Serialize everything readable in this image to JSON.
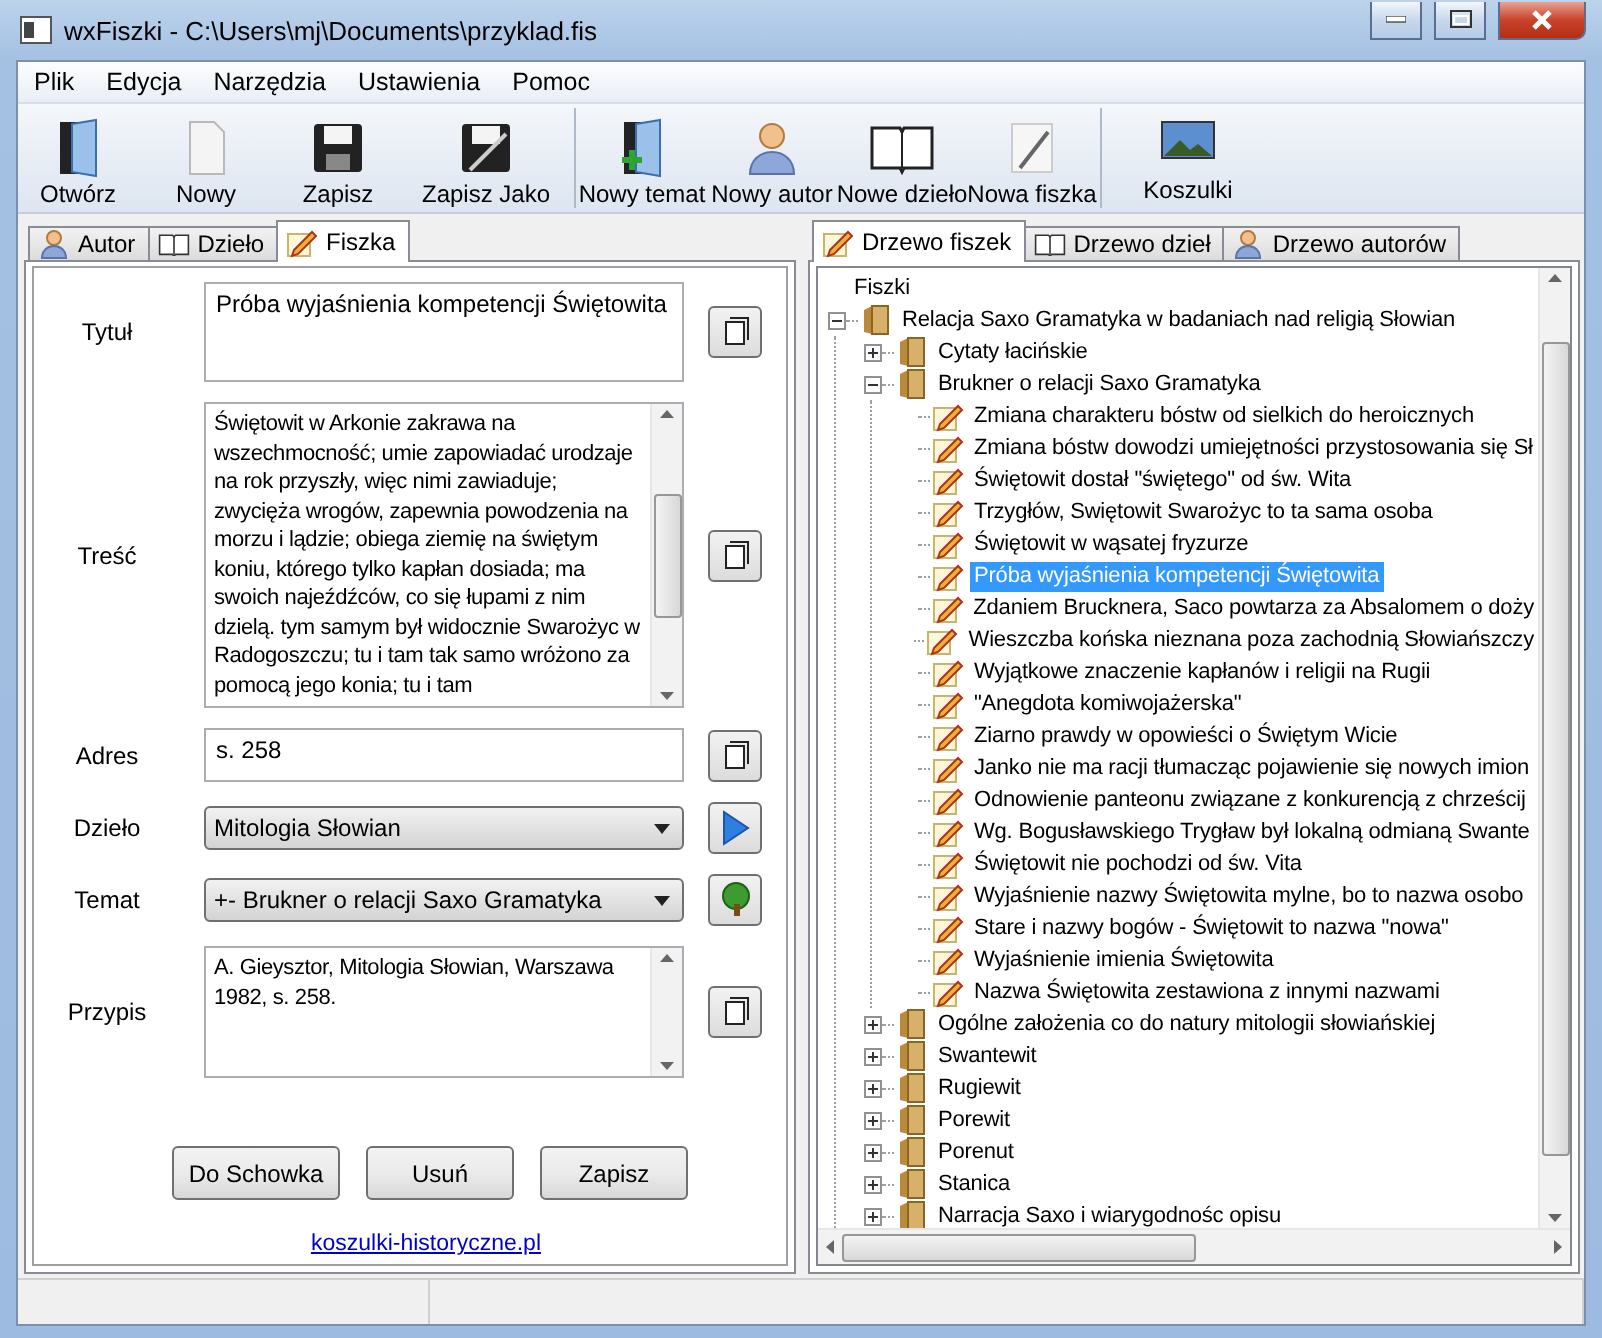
{
  "window": {
    "title": "wxFiszki - C:\\Users\\mj\\Documents\\przyklad.fis"
  },
  "menu": [
    "Plik",
    "Edycja",
    "Narzędzia",
    "Ustawienia",
    "Pomoc"
  ],
  "toolbar": [
    [
      "Otwórz",
      "Nowy",
      "Zapisz",
      "Zapisz Jako"
    ],
    [
      "Nowy temat",
      "Nowy autor",
      "Nowe dzieło",
      "Nowa fiszka"
    ],
    [
      "Koszulki"
    ]
  ],
  "left_tabs": [
    {
      "label": "Autor",
      "selected": false
    },
    {
      "label": "Dzieło",
      "selected": false
    },
    {
      "label": "Fiszka",
      "selected": true
    }
  ],
  "form": {
    "fields": [
      {
        "kind": "text",
        "label": "Tytuł",
        "value": "Próba wyjaśnienia kompetencji Świętowita"
      },
      {
        "kind": "memo",
        "label": "Treść",
        "value": "Świętowit w Arkonie zakrawa na wszechmocność; umie zapowiadać urodzaje na rok przyszły, więc nimi zawiaduje; zwycięża wrogów, zapewnia powodzenia na morzu i lądzie; obiega ziemię na świętym koniu, którego tylko kapłan dosiada; ma swoich najeźdźców, co się łupami z nim dzielą. tym samym był widocznie Swarożyc w Radogoszczu; tu i tam tak samo wróżono za pomocą jego konia; tu i tam"
      },
      {
        "kind": "text",
        "label": "Adres",
        "value": "s. 258"
      },
      {
        "kind": "combo",
        "label": "Dzieło",
        "value": "Mitologia Słowian"
      },
      {
        "kind": "combo",
        "label": "Temat",
        "value": "+- Brukner o relacji Saxo Gramatyka"
      },
      {
        "kind": "memo",
        "label": "Przypis",
        "value": "A. Gieysztor, Mitologia Słowian, Warszawa 1982, s. 258."
      }
    ],
    "buttons": [
      "Do Schowka",
      "Usuń",
      "Zapisz"
    ],
    "link": "koszulki-historyczne.pl"
  },
  "right_tabs": [
    {
      "label": "Drzewo fiszek",
      "selected": true
    },
    {
      "label": "Drzewo dzieł",
      "selected": false
    },
    {
      "label": "Drzewo autorów",
      "selected": false
    }
  ],
  "tree": {
    "root_label": "Fiszki",
    "nodes": [
      {
        "kind": "folder",
        "label": "Relacja Saxo Gramatyka w badaniach nad religią Słowian",
        "expanded": true,
        "selected": false,
        "children": [
          {
            "kind": "folder",
            "label": "Cytaty łacińskie",
            "expanded": false,
            "selected": false
          },
          {
            "kind": "folder",
            "label": "Brukner o relacji Saxo Gramatyka",
            "expanded": true,
            "selected": false,
            "children": [
              {
                "kind": "note",
                "label": "Zmiana charakteru bóstw od sielkich do heroicznych",
                "selected": false
              },
              {
                "kind": "note",
                "label": "Zmiana bóstw dowodzi umiejętności przystosowania się Sł",
                "selected": false
              },
              {
                "kind": "note",
                "label": "Świętowit dostał \"świętego\" od św. Wita",
                "selected": false
              },
              {
                "kind": "note",
                "label": "Trzygłów, Swiętowit Swarożyc to ta sama osoba",
                "selected": false
              },
              {
                "kind": "note",
                "label": "Świętowit w wąsatej fryzurze",
                "selected": false
              },
              {
                "kind": "note",
                "label": "Próba wyjaśnienia kompetencji Świętowita",
                "selected": true
              },
              {
                "kind": "note",
                "label": "Zdaniem Brucknera, Saco powtarza za Absalomem o doży",
                "selected": false
              },
              {
                "kind": "note",
                "label": "Wieszczba końska nieznana poza zachodnią Słowiańszczy",
                "selected": false
              },
              {
                "kind": "note",
                "label": "Wyjątkowe znaczenie kapłanów i religii na Rugii",
                "selected": false
              },
              {
                "kind": "note",
                "label": "\"Anegdota komiwojażerska\"",
                "selected": false
              },
              {
                "kind": "note",
                "label": "Ziarno prawdy w opowieści o Świętym Wicie",
                "selected": false
              },
              {
                "kind": "note",
                "label": "Janko nie ma racji tłumacząc pojawienie się nowych imion",
                "selected": false
              },
              {
                "kind": "note",
                "label": "Odnowienie panteonu związane z konkurencją z chrześcij",
                "selected": false
              },
              {
                "kind": "note",
                "label": "Wg. Bogusławskiego Trygław był lokalną odmianą Swante",
                "selected": false
              },
              {
                "kind": "note",
                "label": "Świętowit nie pochodzi od św. Vita",
                "selected": false
              },
              {
                "kind": "note",
                "label": "Wyjaśnienie nazwy Świętowita mylne, bo to nazwa osobo",
                "selected": false
              },
              {
                "kind": "note",
                "label": "Stare i nazwy bogów - Świętowit to nazwa \"nowa\"",
                "selected": false
              },
              {
                "kind": "note",
                "label": "Wyjaśnienie imienia Świętowita",
                "selected": false
              },
              {
                "kind": "note",
                "label": "Nazwa Świętowita zestawiona z innymi nazwami",
                "selected": false
              }
            ]
          },
          {
            "kind": "folder",
            "label": "Ogólne założenia co do natury mitologii słowiańskiej",
            "expanded": false,
            "selected": false
          },
          {
            "kind": "folder",
            "label": "Swantewit",
            "expanded": false,
            "selected": false
          },
          {
            "kind": "folder",
            "label": "Rugiewit",
            "expanded": false,
            "selected": false
          },
          {
            "kind": "folder",
            "label": "Porewit",
            "expanded": false,
            "selected": false
          },
          {
            "kind": "folder",
            "label": "Porenut",
            "expanded": false,
            "selected": false
          },
          {
            "kind": "folder",
            "label": "Stanica",
            "expanded": false,
            "selected": false
          },
          {
            "kind": "folder",
            "label": "Narracja Saxo i wiarygodnośc opisu",
            "expanded": false,
            "selected": false
          }
        ]
      }
    ]
  }
}
